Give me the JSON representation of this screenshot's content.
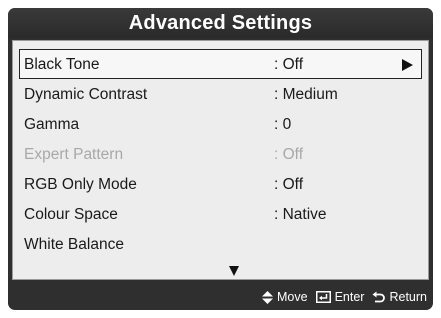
{
  "title": "Advanced Settings",
  "menu": {
    "items": [
      {
        "label": "Black Tone",
        "value": ": Off",
        "state": "selected"
      },
      {
        "label": "Dynamic Contrast",
        "value": ": Medium",
        "state": "normal"
      },
      {
        "label": "Gamma",
        "value": ": 0",
        "state": "normal"
      },
      {
        "label": "Expert Pattern",
        "value": ": Off",
        "state": "disabled"
      },
      {
        "label": "RGB Only Mode",
        "value": ": Off",
        "state": "normal"
      },
      {
        "label": "Colour Space",
        "value": ": Native",
        "state": "normal"
      },
      {
        "label": "White Balance",
        "value": "",
        "state": "normal"
      }
    ]
  },
  "footer": {
    "move_label": "Move",
    "enter_label": "Enter",
    "return_label": "Return"
  },
  "icons": {
    "submenu_arrow": "triangle-right-icon",
    "scroll_indicator": "triangle-down-icon",
    "move": "up-down-arrows-icon",
    "enter": "enter-key-icon",
    "return": "return-arrow-icon"
  },
  "colors": {
    "frame": "#2f2f2f",
    "panel": "#ededed",
    "text": "#1a1a1a",
    "disabled_text": "#a8a8a8",
    "footer_text": "#ffffff"
  }
}
